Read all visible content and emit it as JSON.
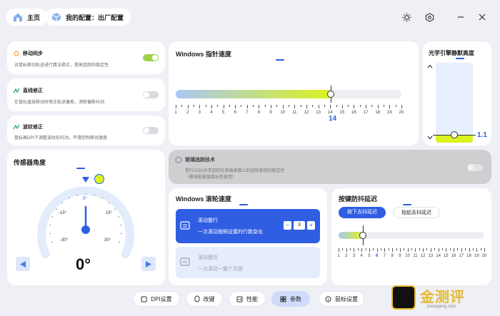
{
  "header": {
    "home_label": "主页",
    "config_label": "我的配置：出厂配置"
  },
  "features": [
    {
      "title": "移动同步",
      "desc": "对鼠标移动轨迹进行算法修正，提高追踪的稳定性",
      "enabled": true
    },
    {
      "title": "直线修正",
      "desc": "在鼠标直线移动时修正轨迹偏差，消除偏移抖动",
      "enabled": false
    },
    {
      "title": "波纹修正",
      "desc": "鼠标高DPI下调整波纹形抖动，平滑控制移动速度",
      "enabled": false
    }
  ],
  "pointer_speed": {
    "title": "Windows 指针速度",
    "value": "14",
    "ticks": [
      "1",
      "2",
      "3",
      "4",
      "5",
      "6",
      "7",
      "8",
      "9",
      "10",
      "11",
      "12",
      "13",
      "14",
      "15",
      "16",
      "17",
      "18",
      "19",
      "20"
    ]
  },
  "lod": {
    "title": "光学引擎静默高度",
    "value": "1.1"
  },
  "glass": {
    "title": "玻璃追踪技术",
    "desc1": "提升2350光学追踪在玻璃桌面上的追踪表现的稳定性",
    "desc2": "（需搭配玻璃鼠标垫使用）"
  },
  "angle": {
    "title": "传感器角度",
    "value": "0°",
    "labels": {
      "zero": "0°",
      "n15": "-15°",
      "p15": "15°",
      "n30": "-30°",
      "p30": "30°"
    }
  },
  "scroll": {
    "title": "Windows 滚轮速度",
    "mode1_title": "滚动整行",
    "mode1_desc": "一次滚动按照设置的行数变化",
    "value": "3",
    "minus": "−",
    "plus": "+",
    "mode2_title": "滚动整页",
    "mode2_desc": "一次滚动一整个页面"
  },
  "debounce": {
    "title": "按键防抖延迟",
    "tab1": "按下去抖延迟",
    "tab2": "抬起去抖延迟",
    "ticks": [
      "1",
      "2",
      "3",
      "4",
      "5",
      "6",
      "7",
      "8",
      "9",
      "10",
      "11",
      "12",
      "13",
      "14",
      "15",
      "16",
      "17",
      "18",
      "19",
      "20"
    ],
    "current_index": 5
  },
  "nav": [
    {
      "label": "DPI设置",
      "icon": "dpi-icon",
      "active": false
    },
    {
      "label": "改键",
      "icon": "mouse-icon",
      "active": false
    },
    {
      "label": "性能",
      "icon": "chart-icon",
      "active": false
    },
    {
      "label": "参数",
      "icon": "grid-icon",
      "active": true
    },
    {
      "label": "鼠标设置",
      "icon": "info-icon",
      "active": false
    }
  ],
  "watermark": {
    "name": "金测评",
    "url": "jincepping.com"
  },
  "colors": {
    "accent": "#2f5ee3",
    "slider_start": "#a9c8f5",
    "slider_end": "#dcf21d"
  }
}
